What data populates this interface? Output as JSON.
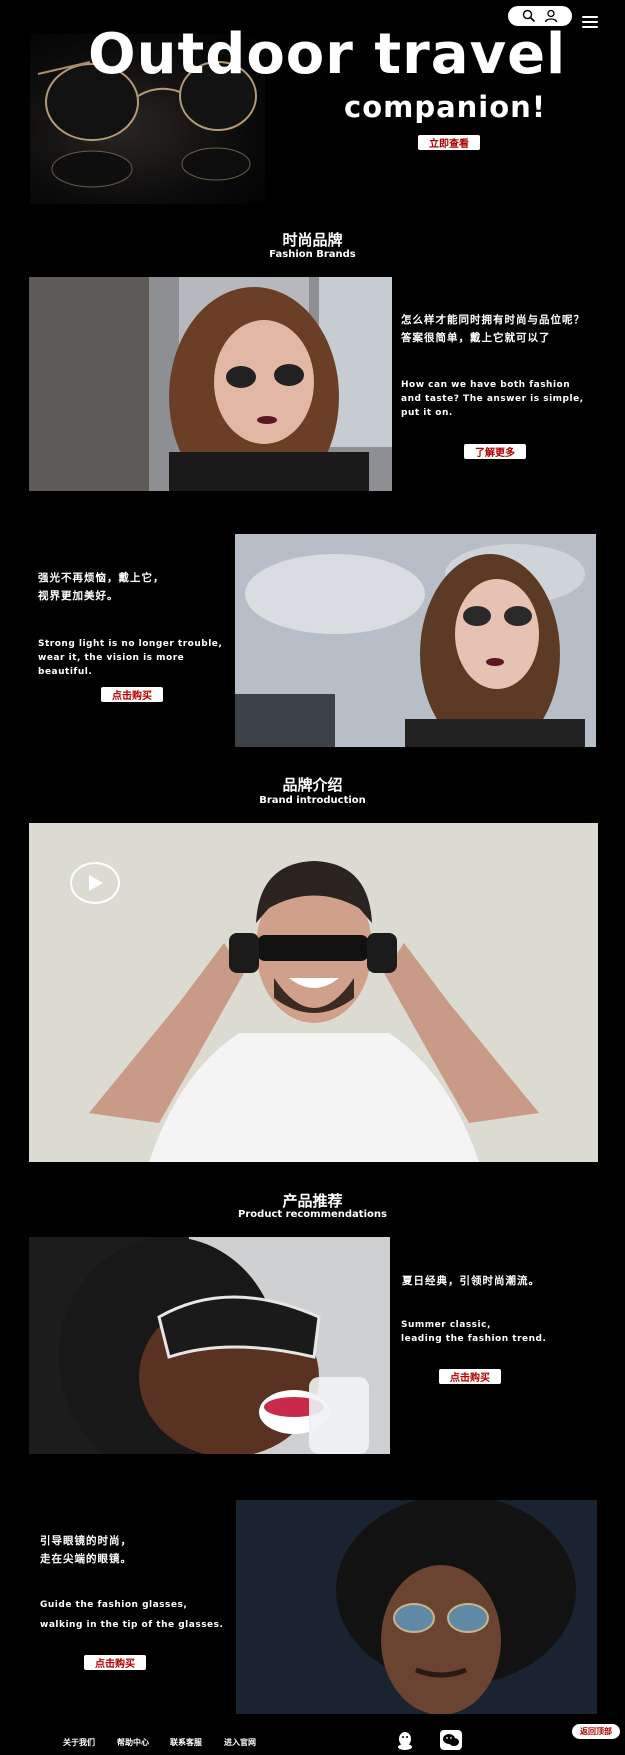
{
  "header": {
    "icons": [
      "search-icon",
      "user-icon",
      "menu-icon"
    ]
  },
  "hero": {
    "title": "Outdoor travel",
    "subtitle": "companion!",
    "button": "立即查看"
  },
  "fashion": {
    "title_cn": "时尚品牌",
    "title_en": "Fashion Brands",
    "block1": {
      "cn_line1": "怎么样才能同时拥有时尚与品位呢？",
      "cn_line2": "答案很简单，戴上它就可以了",
      "en_line1": "How can we have both fashion",
      "en_line2": "and taste? The answer is simple,",
      "en_line3": "put it on.",
      "button": "了解更多"
    },
    "block2": {
      "cn_line1": "强光不再烦恼，戴上它，",
      "cn_line2": "视界更加美好。",
      "en_line1": "Strong light is no longer trouble,",
      "en_line2": "wear it, the vision is more beautiful.",
      "button": "点击购买"
    }
  },
  "brand": {
    "title_cn": "品牌介绍",
    "title_en": "Brand introduction"
  },
  "products": {
    "title_cn": "产品推荐",
    "title_en": "Product recommendations",
    "block1": {
      "cn_line1": "夏日经典，引领时尚潮流。",
      "en_line1": "Summer classic,",
      "en_line2": "leading the fashion trend.",
      "button": "点击购买"
    },
    "block2": {
      "cn_line1": "引导眼镜的时尚，",
      "cn_line2": "走在尖端的眼镜。",
      "en_line1": "Guide the fashion glasses,",
      "en_line2": "walking in the tip of the glasses.",
      "button": "点击购买"
    }
  },
  "footer": {
    "links": [
      "关于我们",
      "帮助中心",
      "联系客服",
      "进入官网"
    ],
    "back_to_top": "返回顶部"
  }
}
